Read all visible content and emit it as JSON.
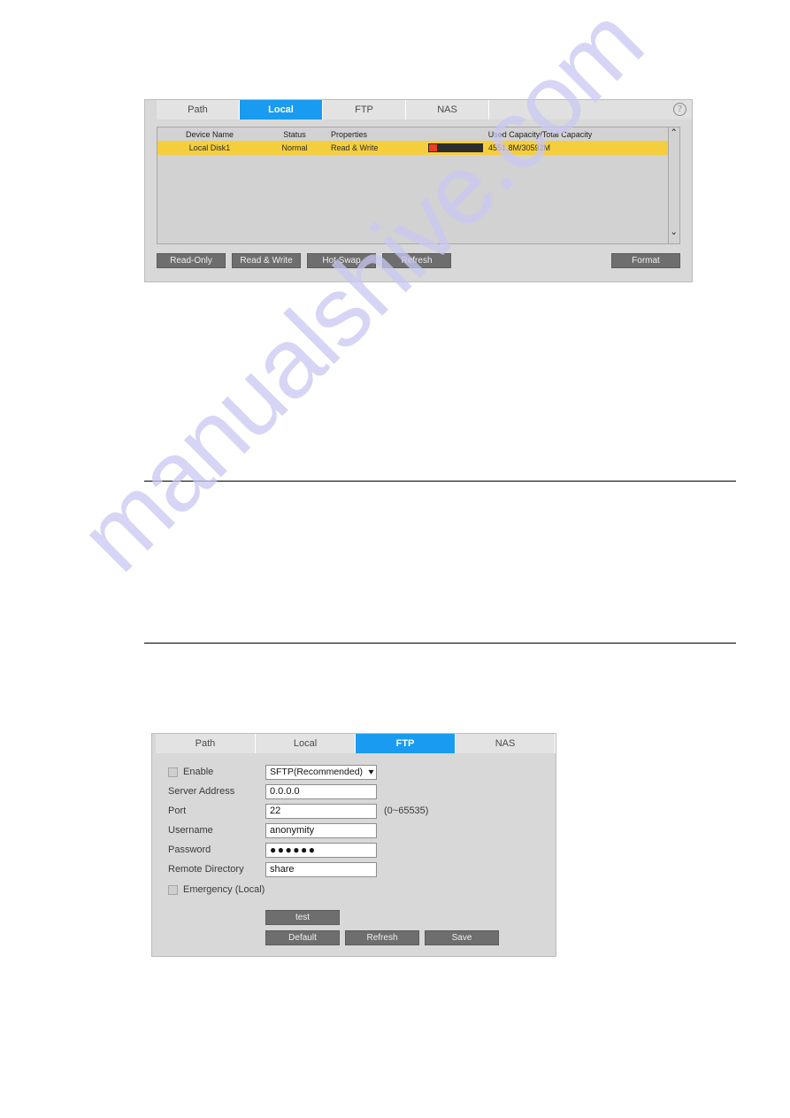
{
  "watermark": {
    "text": "manualshive.com"
  },
  "figure_local": {
    "tabs": [
      {
        "label": "Path",
        "active": false
      },
      {
        "label": "Local",
        "active": true
      },
      {
        "label": "FTP",
        "active": false
      },
      {
        "label": "NAS",
        "active": false
      }
    ],
    "help_icon": "?",
    "table": {
      "headers": [
        "Device Name",
        "Status",
        "Properties",
        "Used Capacity/Total Capacity"
      ],
      "rows": [
        {
          "device_name": "Local Disk1",
          "status": "Normal",
          "properties": "Read & Write",
          "capacity": "4551.8M/30592M",
          "used_percent": 15
        }
      ]
    },
    "scrollbar": {
      "up": "˄",
      "down": "˅"
    },
    "buttons": {
      "read_only": "Read-Only",
      "read_write": "Read & Write",
      "hot_swap": "Hot Swap",
      "refresh": "Refresh",
      "format": "Format"
    }
  },
  "figure_ftp": {
    "tabs": [
      {
        "label": "Path",
        "active": false
      },
      {
        "label": "Local",
        "active": false
      },
      {
        "label": "FTP",
        "active": true
      },
      {
        "label": "NAS",
        "active": false
      }
    ],
    "form": {
      "enable_label": "Enable",
      "protocol_value": "SFTP(Recommended)",
      "server_address_label": "Server Address",
      "server_address_value": "0.0.0.0",
      "port_label": "Port",
      "port_value": "22",
      "port_hint": "(0~65535)",
      "username_label": "Username",
      "username_value": "anonymity",
      "password_label": "Password",
      "password_value": "●●●●●●",
      "remote_directory_label": "Remote Directory",
      "remote_directory_value": "share",
      "emergency_label": "Emergency (Local)"
    },
    "buttons": {
      "test": "test",
      "default": "Default",
      "refresh": "Refresh",
      "save": "Save"
    }
  },
  "colors": {
    "tab_active": "#189bf0",
    "row_highlight": "#f5ce3e",
    "capacity_used": "#ee3d20",
    "capacity_free": "#2e2e2e",
    "button": "#6e6e6e",
    "watermark": "#c9c8f2"
  }
}
